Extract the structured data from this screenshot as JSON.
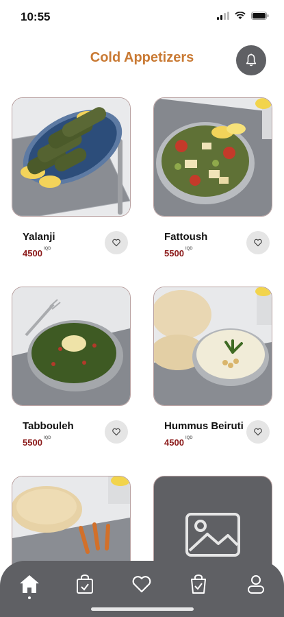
{
  "status_bar": {
    "time": "10:55"
  },
  "header": {
    "title": "Cold Appetizers"
  },
  "products": [
    {
      "name": "Yalanji",
      "price": "4500",
      "currency": "IQD",
      "image": "stuffed-grape-leaves"
    },
    {
      "name": "Fattoush",
      "price": "5500",
      "currency": "IQD",
      "image": "fattoush-salad"
    },
    {
      "name": "Tabbouleh",
      "price": "5500",
      "currency": "IQD",
      "image": "tabbouleh-salad"
    },
    {
      "name": "Hummus Beiruti",
      "price": "4500",
      "currency": "IQD",
      "image": "hummus-with-pita"
    },
    {
      "name": "",
      "price": "",
      "currency": "",
      "image": "pita-bread"
    },
    {
      "name": "",
      "price": "",
      "currency": "",
      "image": "placeholder-image"
    }
  ],
  "bottom_nav": {
    "items": [
      {
        "icon": "home-icon",
        "active": true
      },
      {
        "icon": "orders-bag-icon",
        "active": false
      },
      {
        "icon": "heart-icon",
        "active": false
      },
      {
        "icon": "cart-bag-icon",
        "active": false
      },
      {
        "icon": "profile-icon",
        "active": false
      }
    ]
  },
  "colors": {
    "accent": "#c97a34",
    "price": "#8b1a1a",
    "dark": "#5f6064"
  }
}
